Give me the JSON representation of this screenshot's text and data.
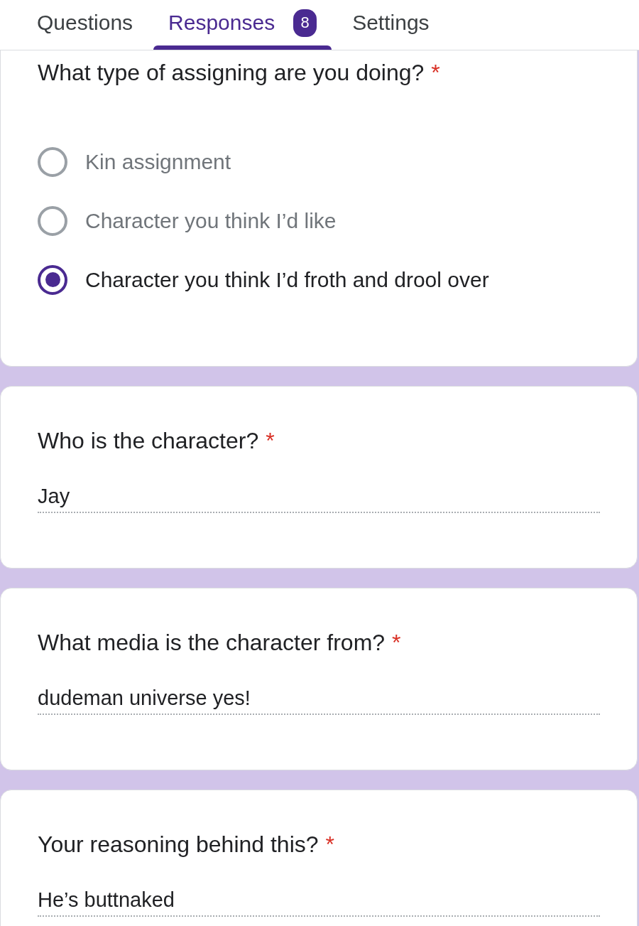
{
  "tabs": [
    {
      "label": "Questions",
      "selected": false
    },
    {
      "label": "Responses",
      "selected": true,
      "badge": "8"
    },
    {
      "label": "Settings",
      "selected": false
    }
  ],
  "questions": [
    {
      "kind": "choice",
      "title": "What type of assigning are you doing?",
      "required_mark": "*",
      "options": [
        {
          "label": "Kin assignment",
          "selected": false
        },
        {
          "label": "Character you think I’d like",
          "selected": false
        },
        {
          "label": "Character you think I’d froth and drool over",
          "selected": true
        }
      ]
    },
    {
      "kind": "text",
      "title": "Who is the character?",
      "required_mark": "*",
      "answer": "Jay"
    },
    {
      "kind": "text",
      "title": "What media is the character from?",
      "required_mark": "*",
      "answer": "dudeman universe yes!"
    },
    {
      "kind": "text",
      "title": "Your reasoning behind this?",
      "required_mark": "*",
      "answer": "He’s buttnaked"
    }
  ]
}
